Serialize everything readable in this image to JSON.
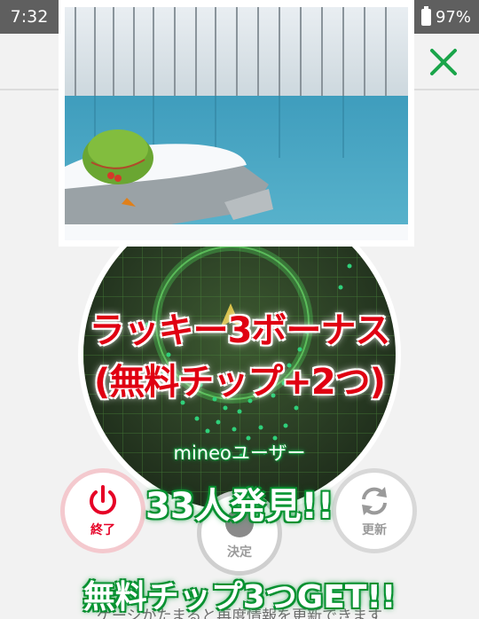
{
  "status_bar": {
    "time": "7:32",
    "battery": "97%"
  },
  "header": {
    "close_icon": "close-x-icon"
  },
  "photo": {
    "description_icon": "scenic-photo"
  },
  "bonus": {
    "line1": "ラッキー3ボーナス",
    "line2": "(無料チップ+2つ)"
  },
  "search_result": {
    "user_label": "mineoユーザー",
    "found_count": "33人発見!!",
    "reward": "無料チップ3つGET!!",
    "footer_note": "ゲージがたまると再度情報を更新できます"
  },
  "buttons": {
    "quit": "終了",
    "decide": "決定",
    "refresh": "更新"
  },
  "colors": {
    "accent_green": "#0a9a37",
    "bonus_red": "#e00012",
    "quit_red": "#e60026",
    "status_bar": "#5f5f5f"
  }
}
